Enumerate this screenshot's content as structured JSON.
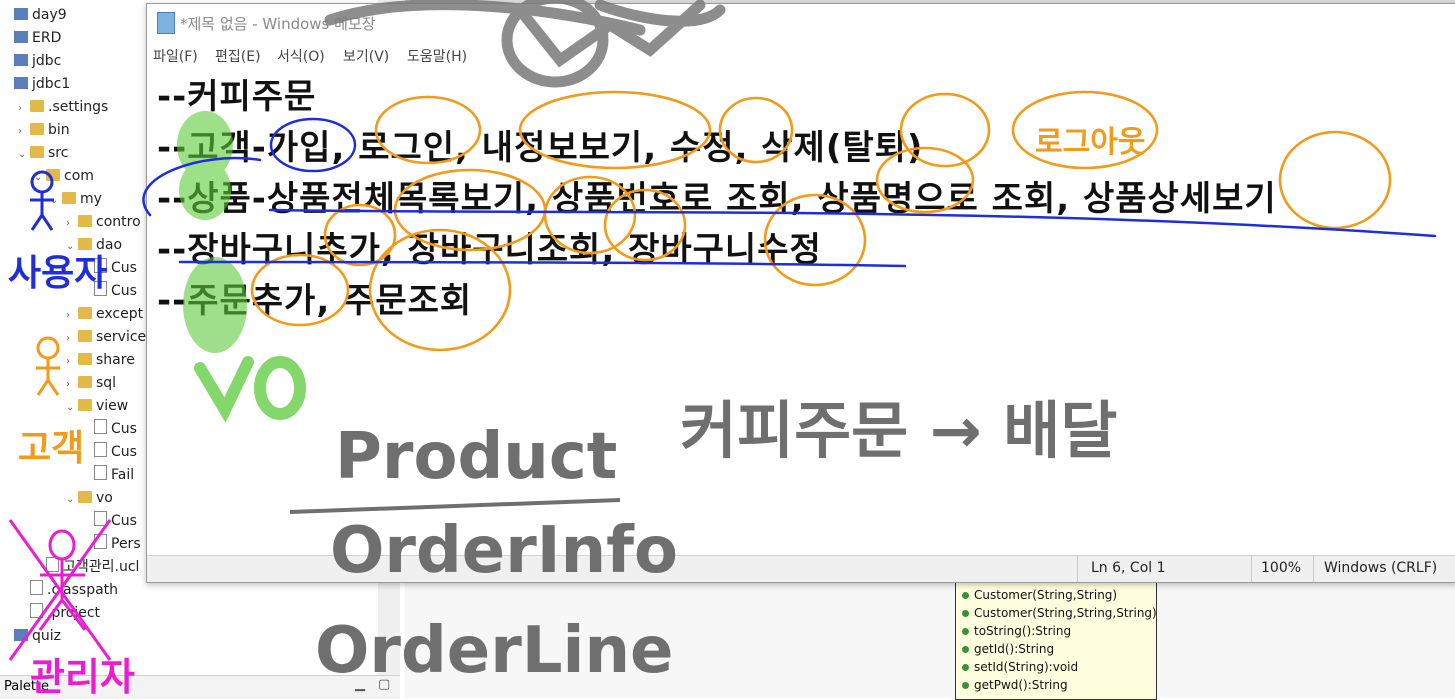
{
  "explorer": {
    "items": [
      {
        "label": "day9",
        "type": "proj",
        "indent": 0,
        "twisty": ""
      },
      {
        "label": "ERD",
        "type": "proj",
        "indent": 0,
        "twisty": ""
      },
      {
        "label": "jdbc",
        "type": "proj",
        "indent": 0,
        "twisty": ""
      },
      {
        "label": "jdbc1",
        "type": "proj",
        "indent": 0,
        "twisty": ""
      },
      {
        "label": ".settings",
        "type": "folder",
        "indent": 1,
        "twisty": "›"
      },
      {
        "label": "bin",
        "type": "folder",
        "indent": 1,
        "twisty": "›"
      },
      {
        "label": "src",
        "type": "folder",
        "indent": 1,
        "twisty": "⌄"
      },
      {
        "label": "com",
        "type": "folder",
        "indent": 2,
        "twisty": "⌄"
      },
      {
        "label": "my",
        "type": "folder",
        "indent": 3,
        "twisty": "⌄"
      },
      {
        "label": "contro",
        "type": "folder",
        "indent": 4,
        "twisty": "›"
      },
      {
        "label": "dao",
        "type": "folder",
        "indent": 4,
        "twisty": "⌄"
      },
      {
        "label": "Cus",
        "type": "file",
        "indent": 5,
        "twisty": ""
      },
      {
        "label": "Cus",
        "type": "file",
        "indent": 5,
        "twisty": ""
      },
      {
        "label": "except",
        "type": "folder",
        "indent": 4,
        "twisty": "›"
      },
      {
        "label": "service",
        "type": "folder",
        "indent": 4,
        "twisty": "›"
      },
      {
        "label": "share",
        "type": "folder",
        "indent": 4,
        "twisty": "›"
      },
      {
        "label": "sql",
        "type": "folder",
        "indent": 4,
        "twisty": "›"
      },
      {
        "label": "view",
        "type": "folder",
        "indent": 4,
        "twisty": "⌄"
      },
      {
        "label": "Cus",
        "type": "file",
        "indent": 5,
        "twisty": ""
      },
      {
        "label": "Cus",
        "type": "file",
        "indent": 5,
        "twisty": ""
      },
      {
        "label": "Fail",
        "type": "file",
        "indent": 5,
        "twisty": ""
      },
      {
        "label": "vo",
        "type": "folder",
        "indent": 4,
        "twisty": "⌄"
      },
      {
        "label": "Cus",
        "type": "file",
        "indent": 5,
        "twisty": ""
      },
      {
        "label": "Pers",
        "type": "file",
        "indent": 5,
        "twisty": ""
      },
      {
        "label": "고객관리.ucl",
        "type": "file",
        "indent": 2,
        "twisty": ""
      },
      {
        "label": ".classpath",
        "type": "file",
        "indent": 1,
        "twisty": ""
      },
      {
        "label": ".project",
        "type": "file",
        "indent": 1,
        "twisty": ""
      },
      {
        "label": "quiz",
        "type": "proj",
        "indent": 0,
        "twisty": ""
      }
    ],
    "palette_label": "Palette"
  },
  "uml": {
    "rows": [
      "Customer(String,String)",
      "Customer(String,String,String)",
      "toString():String",
      "getId():String",
      "setId(String):void",
      "getPwd():String"
    ]
  },
  "notepad": {
    "title": "*제목 없음 - Windows 메모장",
    "menu": [
      "파일(F)",
      "편집(E)",
      "서식(O)",
      "보기(V)",
      "도움말(H)"
    ],
    "lines": [
      "--커피주문",
      "--고객-가입, 로그인, 내정보보기, 수정, 삭제(탈퇴)",
      "--상품-상품전체목록보기, 상품번호로 조회, 상품명으로 조회, 상품상세보기",
      "--장바구니추가, 장바구니조회, 장바구니수정",
      "--주문추가, 주문조회"
    ],
    "status": {
      "position": "Ln 6, Col 1",
      "zoom": "100%",
      "line_ending": "Windows (CRLF)"
    }
  },
  "annotations": {
    "person_labels": [
      "사용자",
      "고객",
      "관리자"
    ],
    "logout": "로그아웃",
    "vo": "VO",
    "classes": [
      "Product",
      "OrderInfo",
      "OrderLine"
    ],
    "coffee_note": "커피주문 → 배달"
  },
  "colors": {
    "ink_orange": "#f29a1a",
    "ink_blue": "#1f2ed8",
    "ink_green": "#5ccc3a",
    "ink_gray": "#6f6f6f",
    "ink_magenta": "#e81ed0"
  }
}
